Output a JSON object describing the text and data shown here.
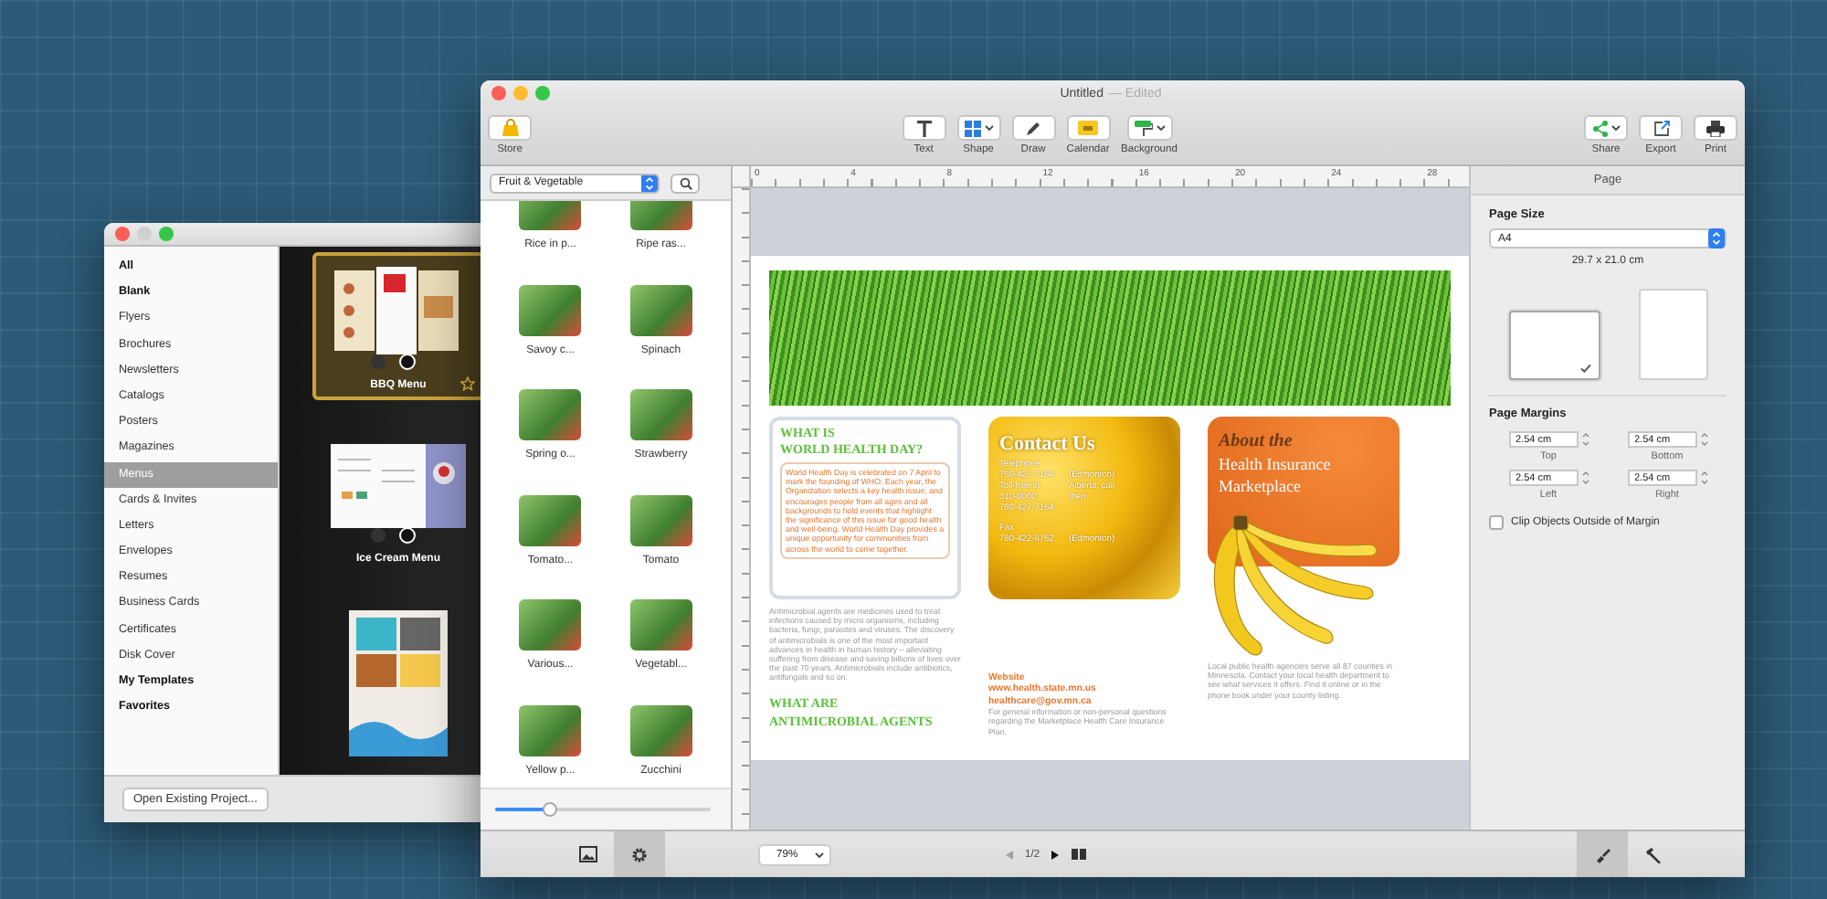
{
  "template_window": {
    "minimize_enabled": false,
    "categories": [
      {
        "label": "All",
        "bold": true,
        "selected": false
      },
      {
        "label": "Blank",
        "bold": true,
        "selected": false
      },
      {
        "label": "Flyers",
        "bold": false,
        "selected": false
      },
      {
        "label": "Brochures",
        "bold": false,
        "selected": false
      },
      {
        "label": "Newsletters",
        "bold": false,
        "selected": false
      },
      {
        "label": "Catalogs",
        "bold": false,
        "selected": false
      },
      {
        "label": "Posters",
        "bold": false,
        "selected": false
      },
      {
        "label": "Magazines",
        "bold": false,
        "selected": false
      },
      {
        "label": "Menus",
        "bold": false,
        "selected": true
      },
      {
        "label": "Cards & Invites",
        "bold": false,
        "selected": false
      },
      {
        "label": "Letters",
        "bold": false,
        "selected": false
      },
      {
        "label": "Envelopes",
        "bold": false,
        "selected": false
      },
      {
        "label": "Resumes",
        "bold": false,
        "selected": false
      },
      {
        "label": "Business Cards",
        "bold": false,
        "selected": false
      },
      {
        "label": "Certificates",
        "bold": false,
        "selected": false
      },
      {
        "label": "Disk Cover",
        "bold": false,
        "selected": false
      },
      {
        "label": "My Templates",
        "bold": true,
        "selected": false
      },
      {
        "label": "Favorites",
        "bold": true,
        "selected": false
      }
    ],
    "templates": [
      {
        "kind": "trifold",
        "label": "BBQ Menu",
        "selected": true
      },
      {
        "kind": "bifold",
        "label": "Ice Cream Menu",
        "selected": false
      },
      {
        "kind": "poster",
        "selected": false
      }
    ],
    "open_button": "Open Existing Project..."
  },
  "editor_window": {
    "title": "Untitled",
    "title_status": "— Edited",
    "toolbar": {
      "left": [
        {
          "kind": "store",
          "label": "Store",
          "menu": false
        }
      ],
      "center": [
        {
          "kind": "text",
          "label": "Text",
          "menu": false
        },
        {
          "kind": "shape",
          "label": "Shape",
          "menu": true
        },
        {
          "kind": "draw",
          "label": "Draw",
          "menu": false
        },
        {
          "kind": "calendar",
          "label": "Calendar",
          "menu": false
        },
        {
          "kind": "background",
          "label": "Background",
          "menu": true
        }
      ],
      "right": [
        {
          "kind": "share",
          "label": "Share",
          "menu": true
        },
        {
          "kind": "export",
          "label": "Export",
          "menu": false
        },
        {
          "kind": "print",
          "label": "Print",
          "menu": false
        }
      ]
    },
    "library": {
      "category": "Fruit & Vegetable",
      "items": [
        {
          "label": "Rice in p..."
        },
        {
          "label": "Ripe ras..."
        },
        {
          "label": "Savoy c..."
        },
        {
          "label": "Spinach"
        },
        {
          "label": "Spring o..."
        },
        {
          "label": "Strawberry"
        },
        {
          "label": "Tomato..."
        },
        {
          "label": "Tomato"
        },
        {
          "label": "Various..."
        },
        {
          "label": "Vegetabl..."
        },
        {
          "label": "Yellow p..."
        },
        {
          "label": "Zucchini"
        }
      ],
      "size_slider": {
        "level": 0.25
      }
    },
    "ruler_labels": [
      "0",
      "4",
      "8",
      "12",
      "16",
      "20",
      "24",
      "28"
    ],
    "document": {
      "health_day": {
        "heading_lines": [
          "WHAT IS",
          "WORLD HEALTH DAY?"
        ],
        "text": "World Health Day is celebrated on 7 April to mark the founding of WHO. Each year, the Organization selects a key health issue, and encourages people from all ages and all backgrounds to hold events that highlight the significance of this issue for good health and well-being. World Health Day provides a unique opportunity for communities from across the world to come together.",
        "body": "Antimicrobial agents are medicines used to treat infections caused by micro organisms, including bacteria, fungi, parasites and viruses. The discovery of antimicrobials is one of the most important advances in health in human history – alleviating suffering from disease and saving billions of lives over the past 70 years. Antimicrobials include antibiotics, antifungals and so on.",
        "footer_lines": [
          "WHAT ARE",
          "ANTIMICROBIAL AGENTS"
        ]
      },
      "contact": {
        "heading": "Contact Us",
        "rows": [
          {
            "left": "Telephone"
          },
          {
            "left": "780-427-7164",
            "right": "(Edmonton)"
          },
          {
            "left": "Toll-free in",
            "right": "Alberta, call"
          },
          {
            "left": "310-0000",
            "right": "then"
          },
          {
            "left": "780-427-7164"
          },
          {
            "left": "Fax"
          },
          {
            "left": "780-422-8762",
            "right": "(Edmonton)"
          }
        ],
        "website_label": "Website",
        "url": "www.health.state.mn.us",
        "email": "healthcare@gov.mn.ca",
        "note": "For general information or non-personal questions regarding the Marketplace Health Care Insurance Plan."
      },
      "about": {
        "kicker": "About the",
        "title": "Health Insurance Marketplace",
        "text": "Local public health agencies serve all 87 counties in Minnesota. Contact your local health department to see what services it offers. Find it online or in the phone book under your county listing."
      }
    },
    "inspector": {
      "tab": "Page",
      "page_size_label": "Page Size",
      "paper": "A4",
      "dimensions": "29.7 x 21.0 cm",
      "orientations": [
        {
          "kind": "landscape",
          "selected": true
        },
        {
          "kind": "portrait",
          "selected": false
        }
      ],
      "margins_label": "Page Margins",
      "margins": [
        {
          "label": "Top",
          "value": "2.54 cm"
        },
        {
          "label": "Bottom",
          "value": "2.54 cm"
        },
        {
          "label": "Left",
          "value": "2.54 cm"
        },
        {
          "label": "Right",
          "value": "2.54 cm"
        }
      ],
      "clip": {
        "label": "Clip Objects Outside of Margin",
        "checked": false
      }
    },
    "bottom_bar": {
      "view_buttons": [
        {
          "kind": "image",
          "selected": false
        },
        {
          "kind": "gear",
          "selected": true
        }
      ],
      "zoom": "79%",
      "page": "1/2",
      "previous_enabled": false,
      "next_enabled": true,
      "inspector_buttons": [
        {
          "kind": "format",
          "selected": true
        },
        {
          "kind": "tools",
          "selected": false
        }
      ]
    }
  }
}
